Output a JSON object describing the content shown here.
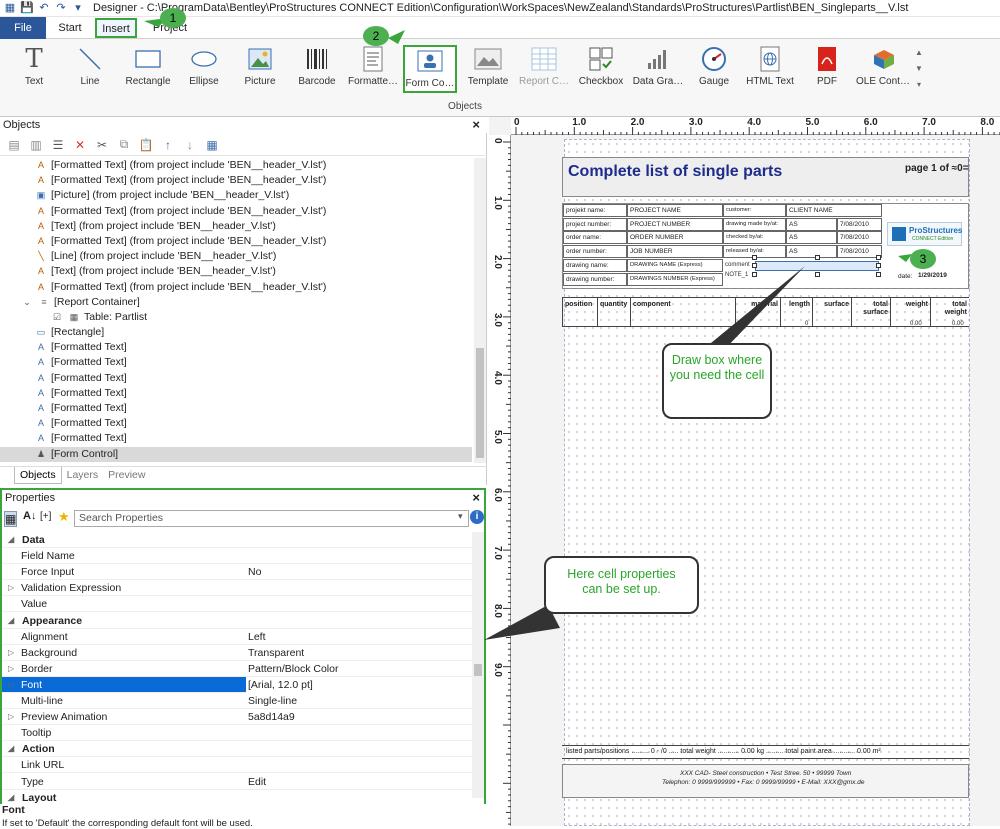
{
  "window": {
    "title": "Designer - C:\\ProgramData\\Bentley\\ProStructures CONNECT Edition\\Configuration\\WorkSpaces\\NewZealand\\Standards\\ProStructures\\Partlist\\BEN_Singleparts__V.lst"
  },
  "menu": {
    "file": "File",
    "start": "Start",
    "insert": "Insert",
    "project": "Project"
  },
  "ribbon": {
    "group_label": "Objects",
    "buttons": [
      {
        "label": "Text",
        "icon": "text-icon"
      },
      {
        "label": "Line",
        "icon": "line-icon"
      },
      {
        "label": "Rectangle",
        "icon": "rectangle-icon"
      },
      {
        "label": "Ellipse",
        "icon": "ellipse-icon"
      },
      {
        "label": "Picture",
        "icon": "picture-icon"
      },
      {
        "label": "Barcode",
        "icon": "barcode-icon"
      },
      {
        "label": "Formatte…",
        "icon": "formatted-text-icon"
      },
      {
        "label": "Form Co…",
        "icon": "form-control-icon"
      },
      {
        "label": "Template",
        "icon": "template-icon"
      },
      {
        "label": "Report C…",
        "icon": "report-container-icon"
      },
      {
        "label": "Checkbox",
        "icon": "checkbox-icon"
      },
      {
        "label": "Data Gra…",
        "icon": "data-graphics-icon"
      },
      {
        "label": "Gauge",
        "icon": "gauge-icon"
      },
      {
        "label": "HTML Text",
        "icon": "html-text-icon"
      },
      {
        "label": "PDF",
        "icon": "pdf-icon"
      },
      {
        "label": "OLE Cont…",
        "icon": "ole-container-icon"
      }
    ]
  },
  "objects_panel": {
    "title": "Objects",
    "tree": [
      {
        "label": "[Formatted Text] (from project include 'BEN__header_V.lst')"
      },
      {
        "label": "[Formatted Text] (from project include 'BEN__header_V.lst')"
      },
      {
        "label": "[Picture] (from project include 'BEN__header_V.lst')"
      },
      {
        "label": "[Formatted Text] (from project include 'BEN__header_V.lst')"
      },
      {
        "label": "[Text] (from project include 'BEN__header_V.lst')"
      },
      {
        "label": "[Formatted Text] (from project include 'BEN__header_V.lst')"
      },
      {
        "label": "[Line] (from project include 'BEN__header_V.lst')"
      },
      {
        "label": "[Text] (from project include 'BEN__header_V.lst')"
      },
      {
        "label": "[Formatted Text] (from project include 'BEN__header_V.lst')"
      },
      {
        "label": "[Report Container]"
      },
      {
        "label": "Table: Partlist"
      },
      {
        "label": "[Rectangle]"
      },
      {
        "label": "[Formatted Text]"
      },
      {
        "label": "[Formatted Text]"
      },
      {
        "label": "[Formatted Text]"
      },
      {
        "label": "[Formatted Text]"
      },
      {
        "label": "[Formatted Text]"
      },
      {
        "label": "[Formatted Text]"
      },
      {
        "label": "[Formatted Text]"
      },
      {
        "label": "[Form Control]"
      }
    ],
    "tabs": [
      "Objects",
      "Layers",
      "Preview"
    ]
  },
  "properties": {
    "title": "Properties",
    "search_placeholder": "Search Properties",
    "rows": [
      {
        "name": "Data",
        "value": "",
        "cat": true
      },
      {
        "name": "Field Name",
        "value": ""
      },
      {
        "name": "Force Input",
        "value": "No"
      },
      {
        "name": "Validation Expression",
        "value": "",
        "exp": true
      },
      {
        "name": "Value",
        "value": ""
      },
      {
        "name": "Appearance",
        "value": "",
        "cat": true
      },
      {
        "name": "Alignment",
        "value": "Left"
      },
      {
        "name": "Background",
        "value": "Transparent",
        "exp": true
      },
      {
        "name": "Border",
        "value": "Pattern/Block Color",
        "exp": true
      },
      {
        "name": "Font",
        "value": "[Arial, 12.0 pt]",
        "exp": true,
        "sel": true
      },
      {
        "name": "Multi-line",
        "value": "Single-line"
      },
      {
        "name": "Preview Animation",
        "value": "5a8d14a9",
        "exp": true
      },
      {
        "name": "Tooltip",
        "value": ""
      },
      {
        "name": "Action",
        "value": "",
        "cat": true
      },
      {
        "name": "Link URL",
        "value": ""
      },
      {
        "name": "Type",
        "value": "Edit"
      },
      {
        "name": "Layout",
        "value": "",
        "cat": true
      }
    ],
    "status_title": "Font",
    "status_text": "If set to 'Default' the corresponding default font will be used."
  },
  "ruler": {
    "h": [
      "0",
      "1.0",
      "2.0",
      "3.0",
      "4.0",
      "5.0",
      "6.0",
      "7.0",
      "8.0"
    ],
    "v": [
      "0",
      "1.0",
      "2.0",
      "3.0",
      "4.0",
      "5.0",
      "6.0",
      "7.0",
      "8.0",
      "9.0"
    ]
  },
  "report": {
    "title": "Complete list of single parts",
    "page": "page 1 of ≈0=",
    "left_labels": [
      "projekt name:",
      "project number:",
      "order name:",
      "order number:",
      "drawing name:",
      "drawing number:"
    ],
    "left_values": [
      "PROJECT NAME",
      "PROJECT NUMBER",
      "ORDER NUMBER",
      "JOB NUMBER",
      "DRAWING NAME (Express)",
      "DRAWINGS NUMBER (Express)"
    ],
    "mid_labels": [
      "customer:",
      "drawing made by/at:",
      "checked by/at:",
      "released by/at:"
    ],
    "mid_values": [
      "CLIENT NAME",
      "AS",
      "AS",
      "AS"
    ],
    "dates": [
      "7/08/2010",
      "7/08/2010",
      "7/08/2010"
    ],
    "comment": "comment",
    "note": "NOTE_1",
    "logo_text": "ProStructures",
    "logo_sub": "CONNECT Edition",
    "date_label": "date:",
    "date_value": "1/29/2019",
    "columns": [
      "position",
      "quantity",
      "component",
      "material",
      "length",
      "surface",
      "total surface",
      "weight",
      "total weight"
    ],
    "row_values": [
      "0",
      "0.00",
      "0.00"
    ],
    "footer_summary": "listed parts/positions ......... 0 - /0 ..... total weight ........... 0.00 kg ......... total paint area ........... 0.00 m²",
    "footer_line1": "XXX CAD- Steel construction • Test Stree. 50 • 99999 Town",
    "footer_line2": "Telephon: 0 9999/999999 • Fax: 0 9999/99999 • E-Mail: XXX@gmx.de"
  },
  "callouts": {
    "draw_box": "Draw box where you need the cell",
    "cell_props": "Here cell properties can be set up."
  },
  "badges": [
    "1",
    "2",
    "3"
  ]
}
